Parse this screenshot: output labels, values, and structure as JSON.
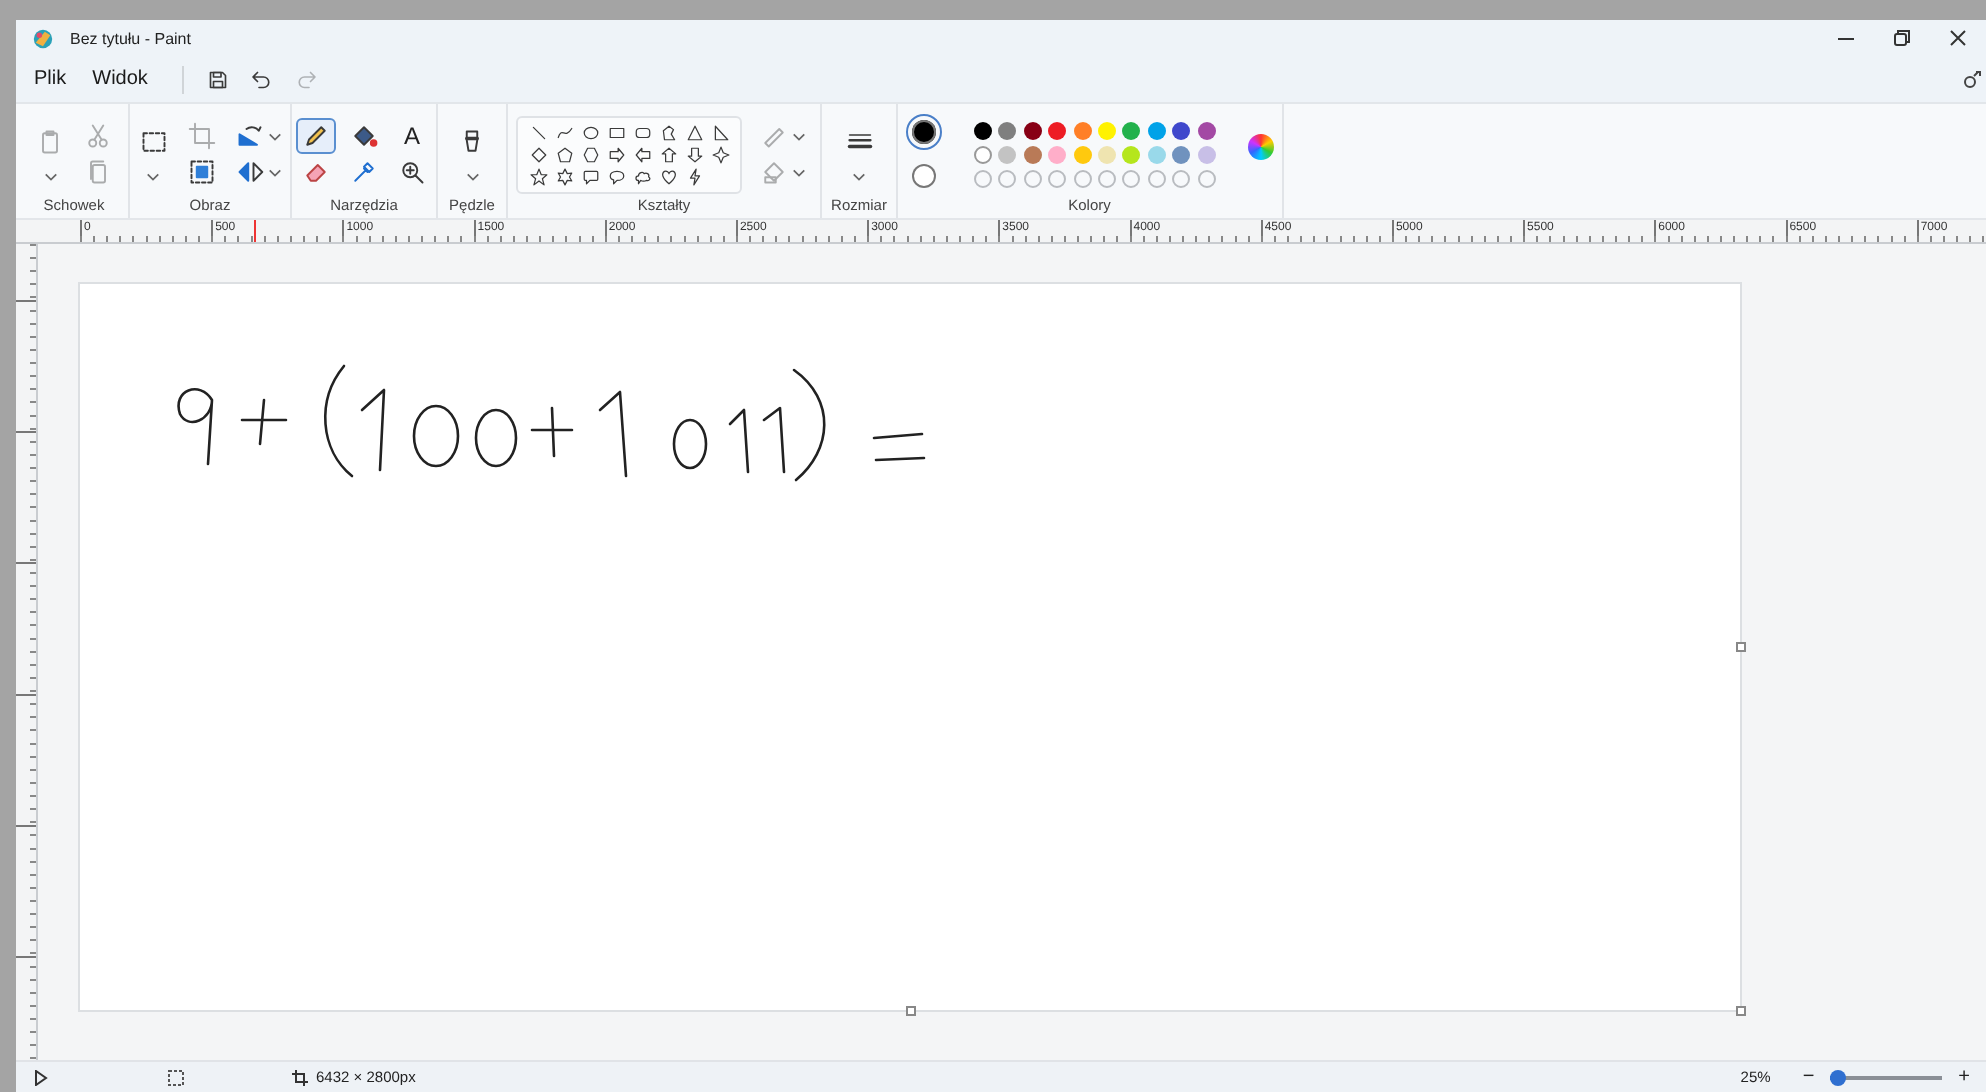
{
  "window": {
    "title": "Bez tytułu - Paint"
  },
  "menu": [
    {
      "label": "Plik"
    },
    {
      "label": "Widok"
    }
  ],
  "quick_actions": [
    {
      "kind": "save",
      "disabled": false
    },
    {
      "kind": "undo",
      "disabled": false
    },
    {
      "kind": "redo",
      "disabled": true
    }
  ],
  "ribbon": {
    "groups": [
      {
        "label": "Schowek",
        "kind": "tools",
        "tools": [
          {
            "kind": "paste",
            "dropdown": true,
            "large": true,
            "disabled": true,
            "selected": false
          },
          {
            "kind": "cut",
            "disabled": true,
            "selected": false
          },
          {
            "kind": "copy",
            "disabled": true,
            "selected": false
          }
        ]
      },
      {
        "label": "Obraz",
        "kind": "tools",
        "tools": [
          {
            "kind": "select",
            "dropdown": true,
            "large": true,
            "disabled": false,
            "selected": false
          },
          {
            "kind": "crop",
            "disabled": true,
            "selected": false
          },
          {
            "kind": "resize",
            "disabled": false,
            "selected": false
          },
          {
            "kind": "rotate",
            "dropdown": true,
            "disabled": false,
            "selected": false
          },
          {
            "kind": "flip",
            "dropdown": true,
            "disabled": false,
            "selected": false
          }
        ]
      },
      {
        "label": "Narzędzia",
        "kind": "tools",
        "tools": [
          {
            "kind": "pencil",
            "disabled": false,
            "selected": true
          },
          {
            "kind": "eraser",
            "disabled": false,
            "selected": false
          },
          {
            "kind": "fill",
            "disabled": false,
            "selected": false
          },
          {
            "kind": "picker",
            "disabled": false,
            "selected": false
          },
          {
            "kind": "text",
            "glyph": "A",
            "disabled": false,
            "selected": false
          },
          {
            "kind": "magnifier",
            "disabled": false,
            "selected": false
          }
        ]
      },
      {
        "label": "Pędzle",
        "kind": "tools",
        "tools": [
          {
            "kind": "brush",
            "dropdown": true,
            "large": true,
            "disabled": false,
            "selected": false
          }
        ]
      },
      {
        "label": "Kształty",
        "kind": "shapes",
        "shapes": [
          {
            "kind": "line"
          },
          {
            "kind": "curve"
          },
          {
            "kind": "oval"
          },
          {
            "kind": "rectangle"
          },
          {
            "kind": "rounded-rectangle"
          },
          {
            "kind": "polygon"
          },
          {
            "kind": "triangle"
          },
          {
            "kind": "right-triangle"
          },
          {
            "kind": "diamond"
          },
          {
            "kind": "pentagon"
          },
          {
            "kind": "hexagon"
          },
          {
            "kind": "right-arrow"
          },
          {
            "kind": "left-arrow"
          },
          {
            "kind": "up-arrow"
          },
          {
            "kind": "down-arrow"
          },
          {
            "kind": "four-point-star"
          },
          {
            "kind": "five-point-star"
          },
          {
            "kind": "six-point-star"
          },
          {
            "kind": "rounded-callout"
          },
          {
            "kind": "oval-callout"
          },
          {
            "kind": "cloud-callout"
          },
          {
            "kind": "heart"
          },
          {
            "kind": "lightning"
          }
        ],
        "tools": [
          {
            "kind": "outline",
            "dropdown": true,
            "disabled": true,
            "selected": false
          },
          {
            "kind": "shape-fill",
            "dropdown": true,
            "disabled": true,
            "selected": false
          }
        ]
      },
      {
        "label": "Rozmiar",
        "kind": "tools",
        "tools": [
          {
            "kind": "size",
            "dropdown": true,
            "large": true,
            "disabled": false,
            "selected": false
          }
        ]
      },
      {
        "label": "Kolory",
        "kind": "colors",
        "current": [
          {
            "color": "#000000",
            "selected": true
          },
          {
            "color": "#ffffff",
            "selected": false
          }
        ],
        "palette": [
          {
            "kind": "swatch",
            "color": "#000000"
          },
          {
            "kind": "swatch",
            "color": "#7f7f7f"
          },
          {
            "kind": "swatch",
            "color": "#880015"
          },
          {
            "kind": "swatch",
            "color": "#ed1c24"
          },
          {
            "kind": "swatch",
            "color": "#ff7f27"
          },
          {
            "kind": "swatch",
            "color": "#fff200"
          },
          {
            "kind": "swatch",
            "color": "#22b14c"
          },
          {
            "kind": "swatch",
            "color": "#00a2e8"
          },
          {
            "kind": "swatch",
            "color": "#3f48cc"
          },
          {
            "kind": "swatch",
            "color": "#a349a4"
          },
          {
            "kind": "swatch",
            "color": "#ffffff"
          },
          {
            "kind": "swatch",
            "color": "#c3c3c3"
          },
          {
            "kind": "swatch",
            "color": "#b97a57"
          },
          {
            "kind": "swatch",
            "color": "#ffaec9"
          },
          {
            "kind": "swatch",
            "color": "#ffc90e"
          },
          {
            "kind": "swatch",
            "color": "#efe4b0"
          },
          {
            "kind": "swatch",
            "color": "#b5e61d"
          },
          {
            "kind": "swatch",
            "color": "#99d9ea"
          },
          {
            "kind": "swatch",
            "color": "#7092be"
          },
          {
            "kind": "swatch",
            "color": "#c8bfe7"
          },
          {
            "kind": "empty"
          },
          {
            "kind": "empty"
          },
          {
            "kind": "empty"
          },
          {
            "kind": "empty"
          },
          {
            "kind": "empty"
          },
          {
            "kind": "empty"
          },
          {
            "kind": "empty"
          },
          {
            "kind": "empty"
          },
          {
            "kind": "empty"
          },
          {
            "kind": "empty"
          }
        ]
      }
    ]
  },
  "ruler": {
    "labels": [
      "0",
      "500",
      "1000",
      "1500",
      "2000",
      "2500",
      "3000",
      "3500",
      "4000",
      "4500",
      "5000",
      "5500",
      "6000",
      "6500",
      "7000"
    ]
  },
  "status_bar": {
    "canvas_size": "6432 × 2800px",
    "zoom": "25%",
    "zoom_out": "−",
    "zoom_in": "+",
    "zoom_slider": {
      "level": 0.07
    }
  }
}
